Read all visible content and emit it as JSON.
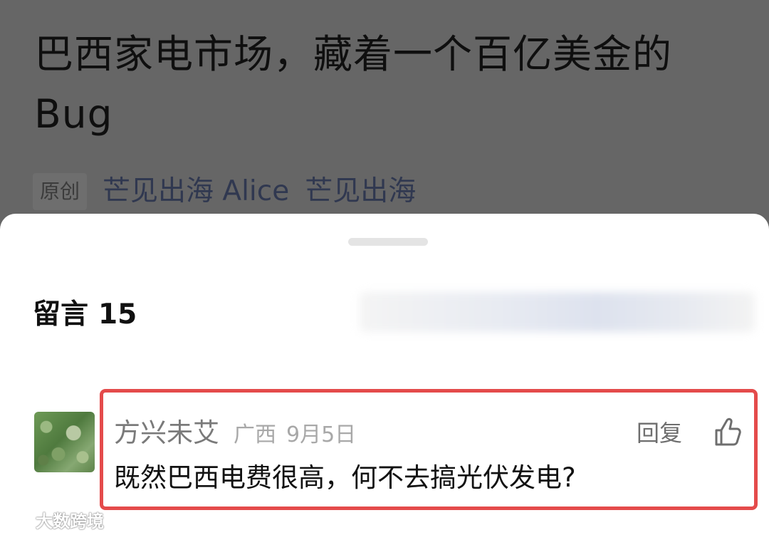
{
  "article": {
    "title": "巴西家电市场，藏着一个百亿美金的Bug",
    "badge": "原创",
    "author": "芒见出海 Alice",
    "account": "芒见出海"
  },
  "comments_sheet": {
    "title": "留言",
    "count": "15"
  },
  "comment": {
    "nickname": "方兴未艾",
    "location": "广西",
    "date": "9月5日",
    "reply_label": "回复",
    "like_icon": "thumbs-up-icon",
    "text": "既然巴西电费很高，何不去搞光伏发电?"
  },
  "watermark": {
    "text": "大数跨境"
  },
  "colors": {
    "highlight": "#e44b4b"
  }
}
